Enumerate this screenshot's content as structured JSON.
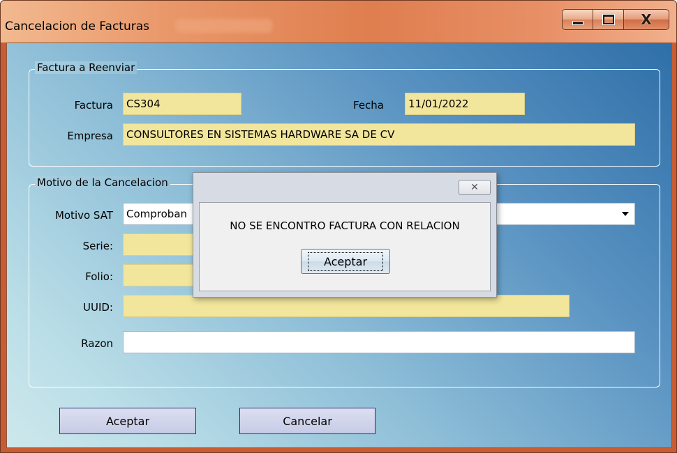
{
  "window": {
    "title": "Cancelacion de Facturas"
  },
  "group_reenviar": {
    "title": "Factura a Reenviar",
    "factura_label": "Factura",
    "factura_value": "CS304",
    "fecha_label": "Fecha",
    "fecha_value": "11/01/2022",
    "empresa_label": "Empresa",
    "empresa_value": "CONSULTORES EN SISTEMAS HARDWARE SA DE CV"
  },
  "group_motivo": {
    "title": "Motivo de la Cancelacion",
    "motivo_sat_label": "Motivo SAT",
    "motivo_sat_value": "Comproban",
    "serie_label": "Serie:",
    "serie_value": "",
    "folio_label": "Folio:",
    "folio_value": "",
    "uuid_label": "UUID:",
    "uuid_value": "",
    "razon_label": "Razon",
    "razon_value": ""
  },
  "buttons": {
    "aceptar": "Aceptar",
    "cancelar": "Cancelar"
  },
  "dialog": {
    "message": "NO SE ENCONTRO FACTURA CON RELACION",
    "ok_label": "Aceptar"
  },
  "colors": {
    "field_yellow": "#f2e69c",
    "title_orange": "#df7e4f",
    "button_border": "#1f2f7a"
  }
}
